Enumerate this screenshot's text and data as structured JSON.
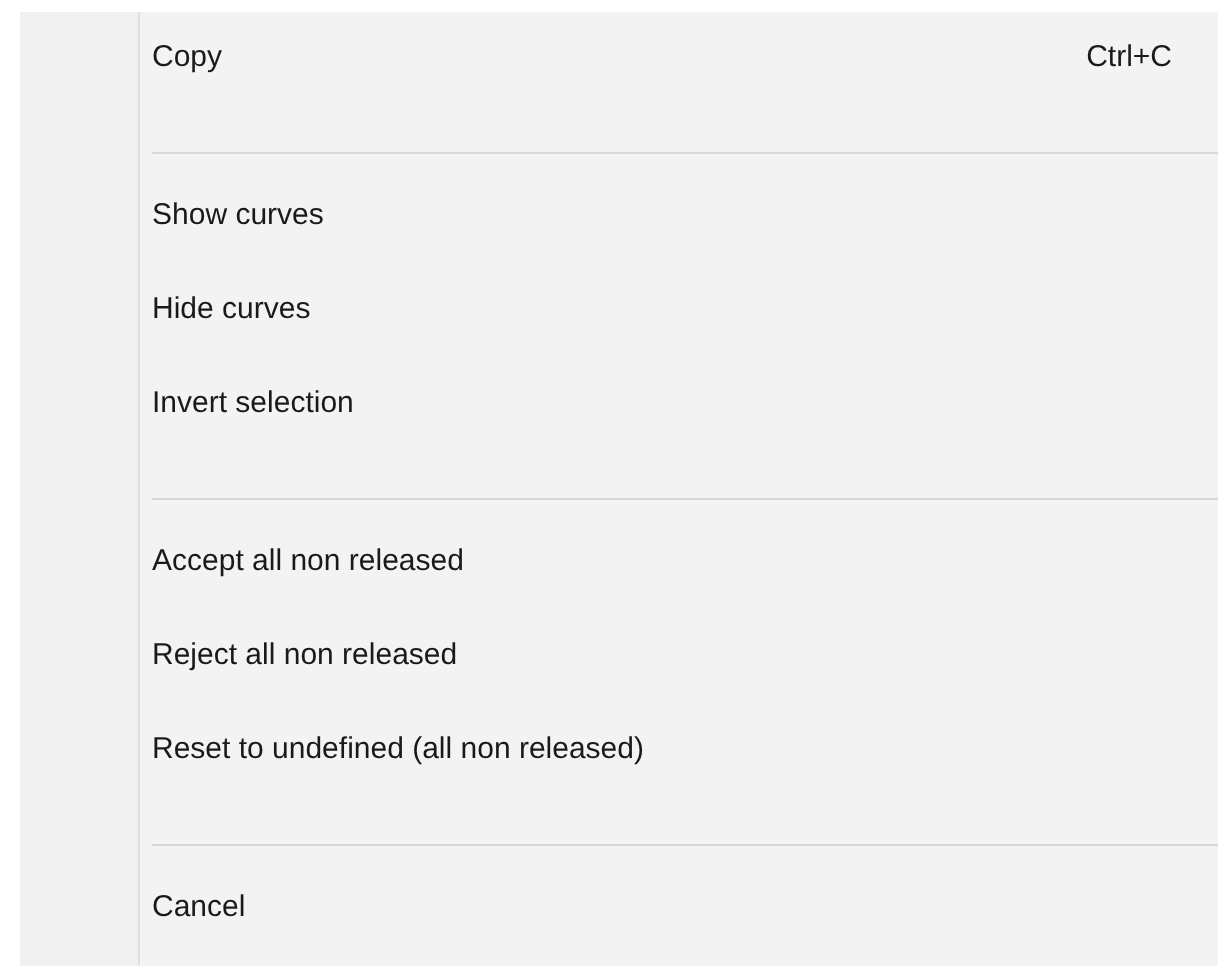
{
  "menu": {
    "items": [
      {
        "kind": "item",
        "label": "Copy",
        "shortcut": "Ctrl+C"
      },
      {
        "kind": "separator"
      },
      {
        "kind": "item",
        "label": "Show curves"
      },
      {
        "kind": "item",
        "label": "Hide curves"
      },
      {
        "kind": "item",
        "label": "Invert selection"
      },
      {
        "kind": "separator"
      },
      {
        "kind": "item",
        "label": "Accept all non released"
      },
      {
        "kind": "item",
        "label": "Reject all non released"
      },
      {
        "kind": "item",
        "label": "Reset to undefined (all non released)"
      },
      {
        "kind": "separator"
      },
      {
        "kind": "item",
        "label": "Cancel"
      }
    ]
  }
}
